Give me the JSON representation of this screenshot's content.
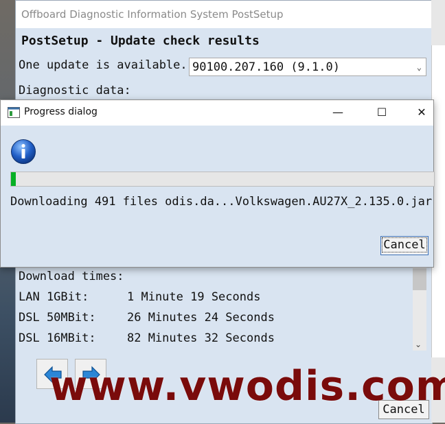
{
  "background_window": {
    "title": "Offboard Diagnostic Information System PostSetup",
    "heading": "PostSetup - Update check results",
    "update_label": "One update is available.",
    "version_selected": "90100.207.160 (9.1.0)",
    "diagnostic_label": "Diagnostic data:",
    "download_times_title": "Download times:",
    "download_times": [
      {
        "connection": "LAN 1GBit:",
        "duration": "1 Minute 19 Seconds"
      },
      {
        "connection": "DSL 50MBit:",
        "duration": "26 Minutes 24 Seconds"
      },
      {
        "connection": "DSL 16MBit:",
        "duration": "82 Minutes 32 Seconds"
      }
    ],
    "cancel_label": "Cancel"
  },
  "progress_dialog": {
    "title": "Progress dialog",
    "progress_fraction": 0.012,
    "status_text": "Downloading 491 files odis.da...Volkswagen.AU27X_2.135.0.jar",
    "cancel_label": "Cancel"
  },
  "watermark": "www.vwodis.com",
  "icons": [
    "app-window-icon",
    "info-icon",
    "minimize-icon",
    "maximize-icon",
    "close-icon",
    "chevron-down-icon",
    "arrow-left-icon",
    "arrow-right-icon"
  ],
  "colors": {
    "progress_fill": "#06b025",
    "dialog_bg": "#d9e4f1",
    "watermark": "#7a0b0b"
  }
}
